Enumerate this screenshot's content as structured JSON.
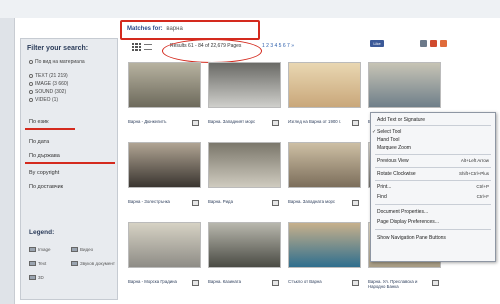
{
  "search": {
    "label": "Matches for:",
    "query": "варна"
  },
  "sidebar": {
    "title": "Filter your search:",
    "groups": [
      "По вид на материала",
      "TEXT (21 219)",
      "IMAGE (3 660)",
      "SOUND (302)",
      "VIDEO (1)"
    ],
    "links": [
      "По език",
      "По дата",
      "По държава",
      "By copyright",
      "По доставчик"
    ],
    "legend_title": "Legend:",
    "legend_items": [
      "Image",
      "Text",
      "3D",
      "Видео",
      "Звуков документ"
    ]
  },
  "toolbar": {
    "results": "Results 61 - 84 of 22,679 Pages",
    "pages": "1 2 3 4 5 6 7 »",
    "like": "Like"
  },
  "items": [
    {
      "caption": "Варна - Дюнкелитъ",
      "palette": [
        "#6d6a5c",
        "#b7b2a0"
      ]
    },
    {
      "caption": "Варна. Западният морс",
      "palette": [
        "#cfcfcb",
        "#6a6a66"
      ]
    },
    {
      "caption": "Изглед на Варна от 1900 г.",
      "palette": [
        "#c9a77a",
        "#e9d7b2"
      ]
    },
    {
      "caption": "Варна",
      "palette": [
        "#6f7f8a",
        "#c7c4b5"
      ]
    },
    {
      "caption": "Варна - Золестрънка",
      "palette": [
        "#3a3530",
        "#b0a493"
      ]
    },
    {
      "caption": "Варна. Рида",
      "palette": [
        "#cfcbbf",
        "#7b776b"
      ]
    },
    {
      "caption": "Варна. Западната морс",
      "palette": [
        "#7c6e5b",
        "#cdbfa4"
      ]
    },
    {
      "caption": "",
      "palette": [
        "#6e6c66",
        "#d8d4ca"
      ]
    },
    {
      "caption": "Варна - Морска Градина",
      "palette": [
        "#8e8c86",
        "#d6d2c4"
      ]
    },
    {
      "caption": "Варна. Казината",
      "palette": [
        "#4a4b44",
        "#b8b7ad"
      ]
    },
    {
      "caption": "Стъкло от Варна",
      "palette": [
        "#2f6f8e",
        "#c7b08b"
      ]
    },
    {
      "caption": "Варна. Ул. Преславска и Народно Банка",
      "palette": [
        "#a89c84",
        "#e0d8c4"
      ]
    }
  ],
  "context_menu": {
    "items": [
      {
        "label": "Add Text or Signature",
        "shortcut": ""
      },
      {
        "label": "Select Tool",
        "shortcut": "",
        "checked": true
      },
      {
        "label": "Hand Tool",
        "shortcut": ""
      },
      {
        "label": "Marquee Zoom",
        "shortcut": ""
      },
      {
        "label": "Previous View",
        "shortcut": "Alt+Left Arrow"
      },
      {
        "label": "Rotate Clockwise",
        "shortcut": "Shift+Ctrl+Plus"
      },
      {
        "label": "Print...",
        "shortcut": "Ctrl+P"
      },
      {
        "label": "Find",
        "shortcut": "Ctrl+F"
      },
      {
        "label": "Document Properties...",
        "shortcut": ""
      },
      {
        "label": "Page Display Preferences...",
        "shortcut": ""
      },
      {
        "label": "Show Navigation Pane Buttons",
        "shortcut": ""
      }
    ]
  },
  "colors": {
    "accent_red": "#d42a1e",
    "facebook_blue": "#3b5998"
  }
}
